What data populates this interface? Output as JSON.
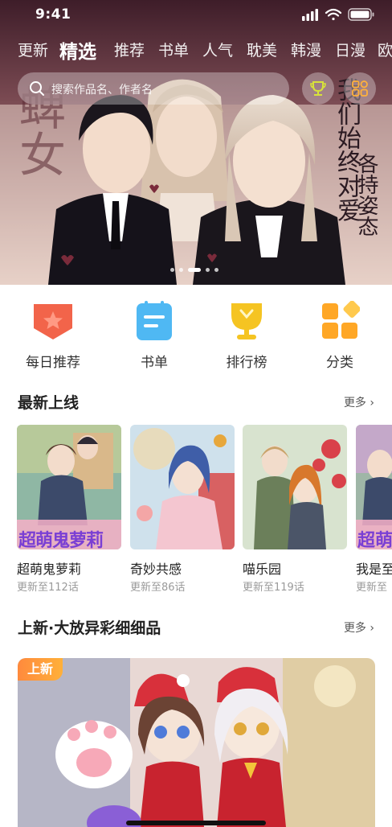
{
  "status": {
    "time": "9:41"
  },
  "tabs": [
    {
      "label": "更新"
    },
    {
      "label": "精选"
    },
    {
      "label": "推荐"
    },
    {
      "label": "书单"
    },
    {
      "label": "人气"
    },
    {
      "label": "耽美"
    },
    {
      "label": "韩漫"
    },
    {
      "label": "日漫"
    },
    {
      "label": "欧"
    }
  ],
  "search": {
    "placeholder": "搜索作品名、作者名"
  },
  "hero": {
    "title": "蜱女",
    "quote_a": "我们始终对爱",
    "quote_b": "各持姿态",
    "slide_count": 5,
    "active_slide": 3
  },
  "quick_nav": [
    {
      "label": "每日推荐",
      "icon": "star-badge-icon",
      "color": "#f2644a"
    },
    {
      "label": "书单",
      "icon": "booklist-icon",
      "color": "#4fb8f3"
    },
    {
      "label": "排行榜",
      "icon": "trophy-icon",
      "color": "#f5c422"
    },
    {
      "label": "分类",
      "icon": "category-grid-icon",
      "color": "#ffa726"
    }
  ],
  "latest": {
    "title": "最新上线",
    "more": "更多 ›",
    "items": [
      {
        "title": "超萌鬼萝莉",
        "subtitle": "更新至112话",
        "cover_text": "超萌鬼萝莉"
      },
      {
        "title": "奇妙共感",
        "subtitle": "更新至86话"
      },
      {
        "title": "喵乐园",
        "subtitle": "更新至119话"
      },
      {
        "title": "我是至",
        "subtitle": "更新至",
        "cover_text": "超萌"
      }
    ]
  },
  "featured": {
    "title": "上新·大放异彩细细品",
    "more": "更多 ›",
    "badge": "上新"
  },
  "colors": {
    "accent": "#ff8a3d",
    "text": "#222222",
    "muted": "#9a9a9a"
  }
}
